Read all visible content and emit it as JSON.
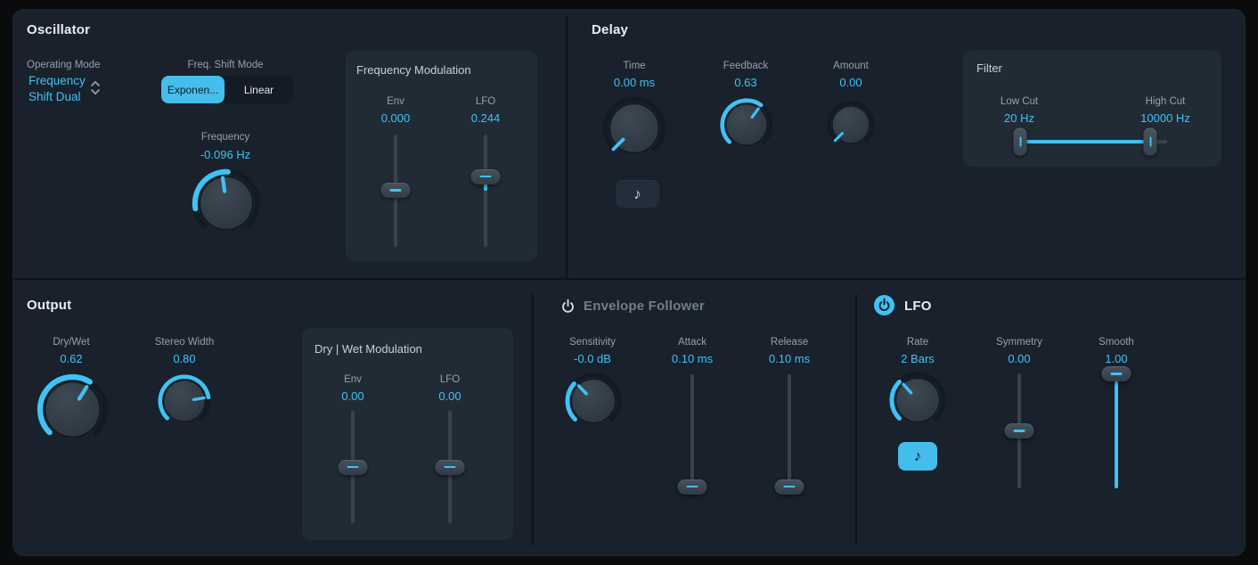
{
  "colors": {
    "accent": "#3EC3F4",
    "background": "#18212C",
    "panel": "#202B36"
  },
  "icons": {
    "note": "♪"
  },
  "oscillator": {
    "title": "Oscillator",
    "operating_mode": {
      "label": "Operating Mode",
      "value": "Frequency Shift Dual",
      "value_line1": "Frequency",
      "value_line2": "Shift Dual"
    },
    "freq_shift_mode": {
      "label": "Freq. Shift Mode",
      "selected": "Exponen...",
      "options": [
        {
          "label": "Exponen...",
          "selected": true
        },
        {
          "label": "Linear",
          "selected": false
        }
      ]
    },
    "frequency": {
      "label": "Frequency",
      "value": "-0.096 Hz",
      "knob": {
        "size": 80,
        "arc": [
          -100,
          3
        ],
        "indicator": -8
      }
    },
    "frequency_modulation": {
      "title": "Frequency Modulation",
      "env": {
        "label": "Env",
        "value": "0.000",
        "slider": {
          "pos": 0.495,
          "fill": null
        }
      },
      "lfo": {
        "label": "LFO",
        "value": "0.244",
        "slider": {
          "pos": 0.374,
          "fill": [
            0.374,
            0.5
          ]
        }
      }
    }
  },
  "delay": {
    "title": "Delay",
    "time": {
      "label": "Time",
      "value": "0.00 ms",
      "knob": {
        "size": 74,
        "arc": null,
        "indicator": -135,
        "ind_r": [
          24,
          45
        ]
      }
    },
    "feedback": {
      "label": "Feedback",
      "value": "0.63",
      "knob": {
        "size": 62,
        "arc": [
          -135,
          36
        ],
        "indicator": 36
      }
    },
    "amount": {
      "label": "Amount",
      "value": "0.00",
      "knob": {
        "size": 56,
        "arc": null,
        "indicator": -135,
        "ind_r": [
          24,
          45
        ]
      }
    },
    "filter": {
      "title": "Filter",
      "low_cut": {
        "label": "Low Cut",
        "value": "20 Hz"
      },
      "high_cut": {
        "label": "High Cut",
        "value": "10000 Hz"
      },
      "range": {
        "low": 0.03,
        "high": 0.888
      }
    }
  },
  "output": {
    "title": "Output",
    "dry_wet": {
      "label": "Dry/Wet",
      "value": "0.62",
      "knob": {
        "size": 83,
        "arc": [
          -135,
          32
        ],
        "indicator": 32
      }
    },
    "stereo_width": {
      "label": "Stereo Width",
      "value": "0.80",
      "knob": {
        "size": 62,
        "arc": [
          -135,
          81
        ],
        "indicator": 81
      }
    },
    "dry_wet_modulation": {
      "title": "Dry | Wet Modulation",
      "env": {
        "label": "Env",
        "value": "0.00",
        "slider": {
          "pos": 0.5,
          "fill": null
        }
      },
      "lfo": {
        "label": "LFO",
        "value": "0.00",
        "slider": {
          "pos": 0.5,
          "fill": null
        }
      }
    }
  },
  "envelope_follower": {
    "title": "Envelope Follower",
    "enabled": false,
    "sensitivity": {
      "label": "Sensitivity",
      "value": "-0.0 dB",
      "knob": {
        "size": 66,
        "arc": [
          -135,
          -48
        ],
        "indicator": -44
      }
    },
    "attack": {
      "label": "Attack",
      "value": "0.10 ms",
      "slider": {
        "pos": 0.955,
        "fill": null
      }
    },
    "release": {
      "label": "Release",
      "value": "0.10 ms",
      "slider": {
        "pos": 0.955,
        "fill": null
      }
    }
  },
  "lfo": {
    "title": "LFO",
    "enabled": true,
    "rate": {
      "label": "Rate",
      "value": "2 Bars",
      "knob": {
        "size": 66,
        "arc": [
          -135,
          -45
        ],
        "indicator": -42
      }
    },
    "symmetry": {
      "label": "Symmetry",
      "value": "0.00",
      "slider": {
        "pos": 0.5,
        "fill": null
      }
    },
    "smooth": {
      "label": "Smooth",
      "value": "1.00",
      "slider": {
        "pos": 0.004,
        "fill": [
          0.004,
          1
        ]
      }
    }
  }
}
